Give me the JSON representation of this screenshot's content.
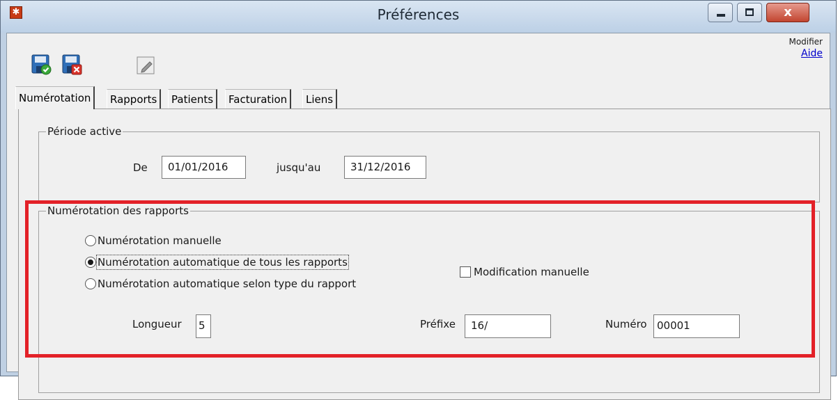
{
  "window": {
    "title": "Préférences",
    "close_glyph": "x"
  },
  "toolbar": {
    "modifier_label": "Modifier",
    "aide_link": "Aide",
    "icons": [
      "save-accept-icon",
      "save-cancel-icon",
      "edit-icon"
    ]
  },
  "tabs": [
    {
      "label": "Numérotation",
      "active": true
    },
    {
      "label": "Rapports",
      "active": false
    },
    {
      "label": "Patients",
      "active": false
    },
    {
      "label": "Facturation",
      "active": false
    },
    {
      "label": "Liens",
      "active": false
    }
  ],
  "periode": {
    "legend": "Période active",
    "de_label": "De",
    "de_value": "01/01/2016",
    "jusquau_label": "jusqu'au",
    "jusquau_value": "31/12/2016"
  },
  "numerotation": {
    "legend": "Numérotation des rapports",
    "options": [
      {
        "label": "Numérotation manuelle",
        "selected": false
      },
      {
        "label": "Numérotation automatique de tous les rapports",
        "selected": true
      },
      {
        "label": "Numérotation automatique selon type du rapport",
        "selected": false
      }
    ],
    "modification_manuelle_label": "Modification manuelle",
    "modification_manuelle_checked": false,
    "longueur_label": "Longueur",
    "longueur_value": "5",
    "prefixe_label": "Préfixe",
    "prefixe_value": "16/",
    "numero_label": "Numéro",
    "numero_value": "00001"
  },
  "colors": {
    "highlight": "#e32128",
    "link": "#0000cc",
    "titlebar": "#c5d6ea"
  }
}
